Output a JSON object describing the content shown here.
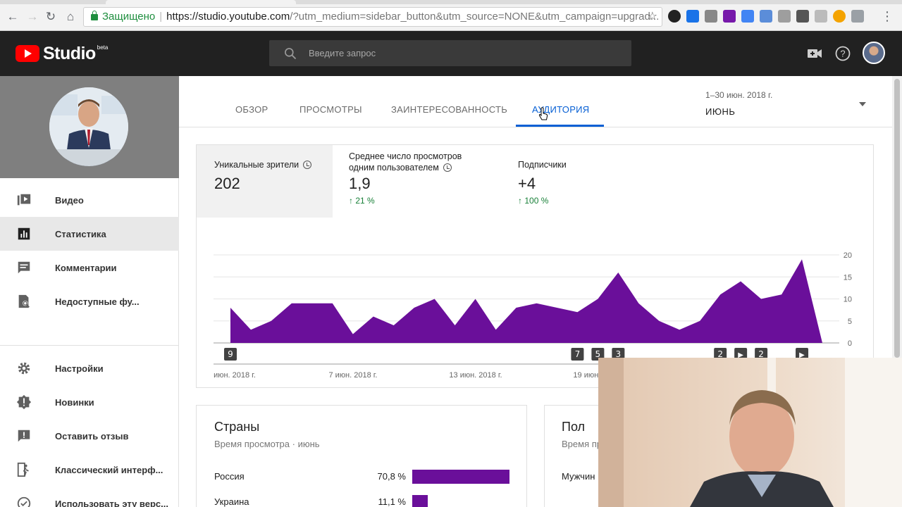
{
  "browser": {
    "secure_label": "Защищено",
    "url_host": "https://studio.youtube.com",
    "url_rest": "/?utm_medium=sidebar_button&utm_source=NONE&utm_campaign=upgrad..."
  },
  "header": {
    "logo_text": "Studio",
    "logo_badge": "beta",
    "search_placeholder": "Введите запрос"
  },
  "sidebar": {
    "items": [
      {
        "label": "Видео",
        "icon": "video-icon"
      },
      {
        "label": "Статистика",
        "icon": "analytics-icon",
        "active": true
      },
      {
        "label": "Комментарии",
        "icon": "comments-icon"
      },
      {
        "label": "Недоступные фу...",
        "icon": "unavailable-features-icon"
      },
      {
        "label": "Настройки",
        "icon": "gear-icon"
      },
      {
        "label": "Новинки",
        "icon": "whats-new-icon"
      },
      {
        "label": "Оставить отзыв",
        "icon": "feedback-icon"
      },
      {
        "label": "Классический интерф...",
        "icon": "classic-studio-icon"
      },
      {
        "label": "Использовать эту верс...",
        "icon": "check-circle-icon"
      }
    ]
  },
  "tabs": [
    {
      "label": "ОБЗОР"
    },
    {
      "label": "ПРОСМОТРЫ"
    },
    {
      "label": "ЗАИНТЕРЕСОВАННОСТЬ"
    },
    {
      "label": "АУДИТОРИЯ",
      "active": true
    }
  ],
  "date": {
    "range": "1–30 июн. 2018 г.",
    "month": "ИЮНЬ"
  },
  "metrics": [
    {
      "label": "Уникальные зрители",
      "value": "202",
      "change": ""
    },
    {
      "label": "Среднее число просмотров одним пользователем",
      "value": "1,9",
      "change": "21 %"
    },
    {
      "label": "Подписчики",
      "value": "+4",
      "change": "100 %"
    }
  ],
  "chart_data": {
    "type": "area",
    "x": [
      "1",
      "2",
      "3",
      "4",
      "5",
      "6",
      "7",
      "8",
      "9",
      "10",
      "11",
      "12",
      "13",
      "14",
      "15",
      "16",
      "17",
      "18",
      "19",
      "20",
      "21",
      "22",
      "23",
      "24",
      "25",
      "26",
      "27",
      "28",
      "29",
      "30"
    ],
    "values": [
      8,
      3,
      5,
      9,
      9,
      9,
      2,
      6,
      4,
      8,
      10,
      4,
      10,
      3,
      8,
      9,
      8,
      7,
      10,
      16,
      9,
      5,
      3,
      5,
      11,
      14,
      10,
      11,
      19,
      0
    ],
    "ylim": [
      0,
      20
    ],
    "y_ticks": [
      "0",
      "5",
      "10",
      "15",
      "20"
    ],
    "x_tick_labels": [
      "июн. 2018 г.",
      "7 июн. 2018 г.",
      "13 июн. 2018 г.",
      "19 июн. 2018 г."
    ],
    "color": "#6a0f9a",
    "annotations": [
      {
        "day": 1,
        "label": "9"
      },
      {
        "day": 18,
        "label": "7"
      },
      {
        "day": 19,
        "label": "5"
      },
      {
        "day": 20,
        "label": "3"
      },
      {
        "day": 25,
        "label": "2"
      },
      {
        "day": 26,
        "label": "▶"
      },
      {
        "day": 27,
        "label": "2"
      },
      {
        "day": 29,
        "label": "▶"
      }
    ]
  },
  "countries": {
    "title": "Страны",
    "subtitle": "Время просмотра · июнь",
    "rows": [
      {
        "name": "Россия",
        "value": "70,8 %",
        "share": 70.8
      },
      {
        "name": "Украина",
        "value": "11,1 %",
        "share": 11.1
      }
    ]
  },
  "gender": {
    "title": "Пол",
    "subtitle": "Время пр",
    "row_label": "Мужчин"
  }
}
